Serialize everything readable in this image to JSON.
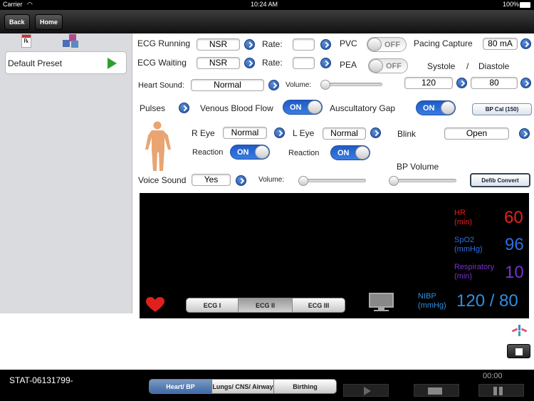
{
  "status": {
    "carrier": "Carrier",
    "time": "10:24 AM",
    "battery": "100%"
  },
  "nav": {
    "back": "Back",
    "home": "Home"
  },
  "sidebar": {
    "preset_label": "Default Preset"
  },
  "ecg": {
    "running_label": "ECG Running",
    "running_value": "NSR",
    "waiting_label": "ECG Waiting",
    "waiting_value": "NSR",
    "rate_label": "Rate:",
    "rate_running": "",
    "rate_waiting": "",
    "pvc_label": "PVC",
    "pvc_state": "OFF",
    "pea_label": "PEA",
    "pea_state": "OFF",
    "pacing_label": "Pacing Capture",
    "pacing_value": "80 mA",
    "systole_label": "Systole",
    "slash": "/",
    "diastole_label": "Diastole",
    "systole_value": "120",
    "diastole_value": "80"
  },
  "sounds": {
    "heart_label": "Heart Sound:",
    "heart_value": "Normal",
    "volume_label": "Volume:",
    "volume_level": 0.0
  },
  "pulses": {
    "pulses_label": "Pulses",
    "vbf_label": "Venous Blood Flow",
    "vbf_state": "ON",
    "gap_label": "Auscultatory Gap",
    "gap_state": "ON",
    "bpcal_label": "BP Cal (150)"
  },
  "eyes": {
    "reye_label": "R Eye",
    "reye_value": "Normal",
    "leye_label": "L Eye",
    "leye_value": "Normal",
    "blink_label": "Blink",
    "blink_value": "Open",
    "reaction_label": "Reaction",
    "reaction_r_state": "ON",
    "reaction_l_state": "ON"
  },
  "voice": {
    "voice_label": "Voice Sound",
    "voice_value": "Yes",
    "volume_label": "Volume:",
    "volume_level": 0.0,
    "bp_volume_label": "BP Volume",
    "bp_volume_level": 0.0,
    "defib_label": "Defib Convert"
  },
  "monitor": {
    "hr_label": "HR",
    "hr_unit": "(min)",
    "hr_value": "60",
    "hr_color": "#e8201c",
    "spo2_label": "SpO2",
    "spo2_unit": "(mmHg)",
    "spo2_value": "96",
    "spo2_color": "#2f6fe0",
    "resp_label": "Respiratory",
    "resp_unit": "(min)",
    "resp_value": "10",
    "resp_color": "#7a2fcf",
    "nibp_label": "NIBP",
    "nibp_unit": "(mmHg)",
    "nibp_value": "120 / 80",
    "nibp_color": "#2f8fe0",
    "tabs": [
      "ECG I",
      "ECG II",
      "ECG III"
    ],
    "selected_tab": "ECG II"
  },
  "bottom": {
    "case_id": "STAT-06131799-",
    "timer": "00:00",
    "tabs": [
      "Heart/ BP",
      "Lungs/ CNS/ Airway",
      "Birthing"
    ],
    "selected_tab": "Heart/ BP"
  }
}
